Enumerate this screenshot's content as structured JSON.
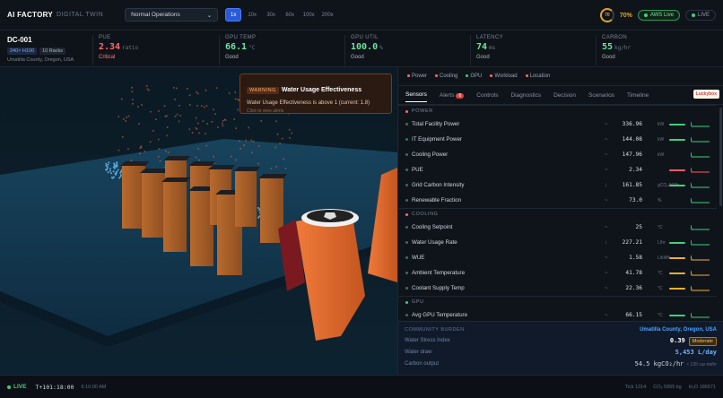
{
  "topbar": {
    "brand": "AI FACTORY",
    "brand_sub": "DIGITAL TWIN",
    "mode": "Normal Operations",
    "speeds": [
      "1x",
      "10x",
      "30x",
      "60x",
      "100x",
      "200x"
    ],
    "active_speed": "1x",
    "score_ring": "70",
    "score": "70%",
    "aws": "AWS Live",
    "live": "LIVE"
  },
  "site": {
    "id": "DC-001",
    "tags": [
      "240× H100",
      "10 Racks"
    ],
    "location": "Umatilla County, Oregon, USA"
  },
  "metrics": [
    {
      "label": "PUE",
      "value": "2.34",
      "unit": "ratio",
      "status": "Critical",
      "color": "#ff6b6b",
      "status_color": "#ff7b7b"
    },
    {
      "label": "GPU TEMP",
      "value": "66.1",
      "unit": "°C",
      "status": "Good",
      "color": "#6fe3a0",
      "status_color": "#aab3bd"
    },
    {
      "label": "GPU UTIL",
      "value": "100.0",
      "unit": "%",
      "status": "Good",
      "color": "#6fe3a0",
      "status_color": "#aab3bd"
    },
    {
      "label": "LATENCY",
      "value": "74",
      "unit": "ms",
      "status": "Good",
      "color": "#6fe3a0",
      "status_color": "#aab3bd"
    },
    {
      "label": "CARBON",
      "value": "55",
      "unit": "kg/hr",
      "status": "Good",
      "color": "#6fe3a0",
      "status_color": "#aab3bd"
    }
  ],
  "toast": {
    "tag": "WARNING",
    "title": "Water Usage Effectiveness",
    "body": "Water Usage Effectiveness is above 1 (current: 1.8)",
    "hint": "Click to view alerts"
  },
  "filters": [
    {
      "label": "Power",
      "color": "#ff6b6b"
    },
    {
      "label": "Cooling",
      "color": "#ff6b6b"
    },
    {
      "label": "GPU",
      "color": "#3fd07a"
    },
    {
      "label": "Workload",
      "color": "#ff6b6b"
    },
    {
      "label": "Location",
      "color": "#ff6b6b"
    }
  ],
  "tabs": [
    "Sensors",
    "Alerts",
    "Controls",
    "Diagnostics",
    "Decision",
    "Scenarios",
    "Timeline"
  ],
  "alerts_count": "6",
  "lucky_badge": "Luckybox",
  "sections": [
    {
      "title": "POWER",
      "color": "#ff6b6b",
      "rows": [
        {
          "name": "Total Facility Power",
          "trend": "~",
          "value": "336.96",
          "unit": "kW",
          "bar": "#3fd07a"
        },
        {
          "name": "IT Equipment Power",
          "trend": "~",
          "value": "144.08",
          "unit": "kW",
          "bar": "#3fd07a"
        },
        {
          "name": "Cooling Power",
          "trend": "~",
          "value": "147.96",
          "unit": "kW",
          "bar": ""
        },
        {
          "name": "PUE",
          "trend": "~",
          "value": "2.34",
          "unit": "",
          "bar": "#ff5a6a"
        },
        {
          "name": "Grid Carbon Intensity",
          "trend": "↓",
          "value": "161.85",
          "unit": "gCO₂/kWh",
          "bar": "#3fd07a"
        },
        {
          "name": "Renewable Fraction",
          "trend": "~",
          "value": "73.0",
          "unit": "%",
          "bar": ""
        }
      ]
    },
    {
      "title": "COOLING",
      "color": "#ff6b6b",
      "rows": [
        {
          "name": "Cooling Setpoint",
          "trend": "~",
          "value": "25",
          "unit": "°C",
          "bar": ""
        },
        {
          "name": "Water Usage Rate",
          "trend": "↓",
          "value": "227.21",
          "unit": "L/hr",
          "bar": "#3fd07a"
        },
        {
          "name": "WUE",
          "trend": "~",
          "value": "1.58",
          "unit": "L/kWh",
          "bar": "#f0b030"
        },
        {
          "name": "Ambient Temperature",
          "trend": "~",
          "value": "41.78",
          "unit": "°C",
          "bar": "#f0b030"
        },
        {
          "name": "Coolant Supply Temp",
          "trend": "~",
          "value": "22.36",
          "unit": "°C",
          "bar": "#f0b030"
        }
      ]
    },
    {
      "title": "GPU",
      "color": "#3fd07a",
      "rows": [
        {
          "name": "Avg GPU Temperature",
          "trend": "~",
          "value": "66.15",
          "unit": "°C",
          "bar": "#3fd07a"
        }
      ]
    }
  ],
  "community": {
    "title": "COMMUNITY BURDEN",
    "location": "Umatilla County, Oregon, USA",
    "stress_label": "Water Stress Index",
    "stress_value": "0.39",
    "stress_level": "Moderate",
    "draw_label": "Water draw",
    "draw_value": "5,453 L/day",
    "carbon_label": "Carbon output",
    "carbon_value": "54.5 kgCO₂/hr",
    "carbon_sub": "≈ 135 car-mi/hr"
  },
  "footer": {
    "live": "LIVE",
    "time": "T+101:18:00",
    "clock": "6:10:00 AM",
    "tick": "Tick 1314",
    "co2": "CO₂ 5955 kg",
    "h2o": "H₂O 186571"
  }
}
